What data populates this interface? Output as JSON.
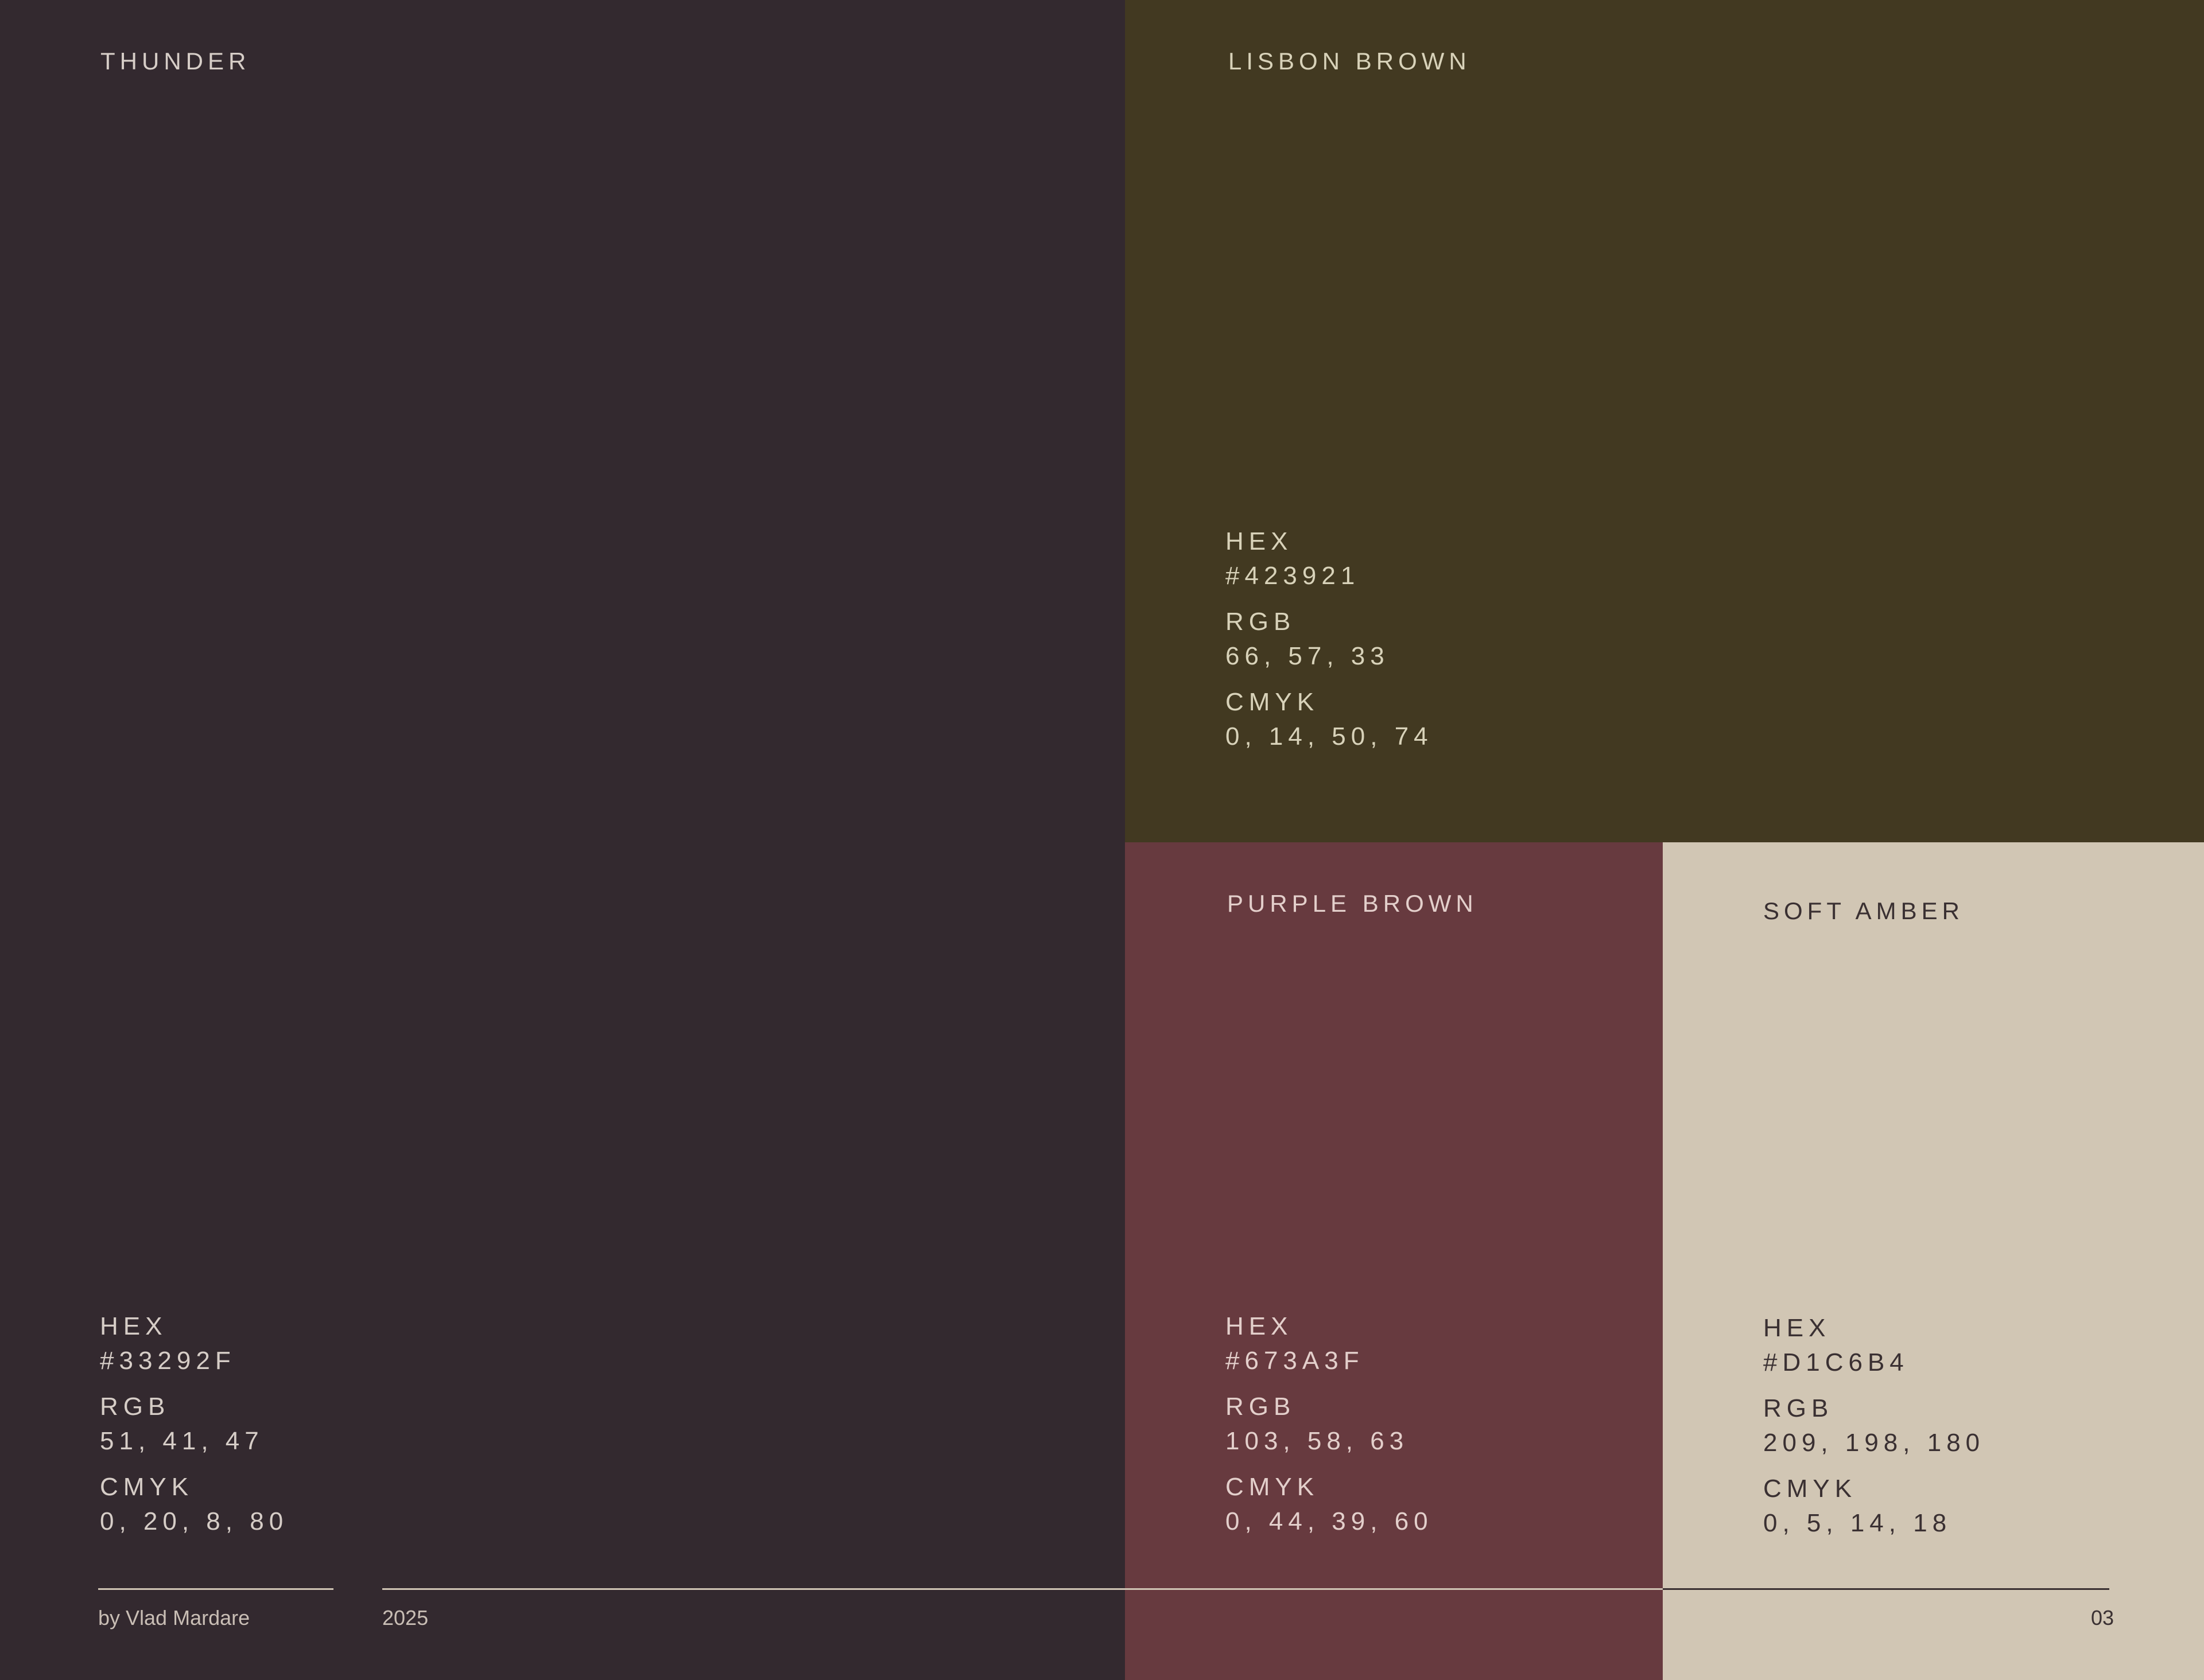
{
  "swatches": [
    {
      "name": "THUNDER",
      "color": "#33292F",
      "hex_label": "HEX",
      "hex": "#33292F",
      "rgb_label": "RGB",
      "rgb": "51, 41, 47",
      "cmyk_label": "CMYK",
      "cmyk": "0, 20, 8, 80"
    },
    {
      "name": "LISBON BROWN",
      "color": "#423921",
      "hex_label": "HEX",
      "hex": "#423921",
      "rgb_label": "RGB",
      "rgb": "66, 57, 33",
      "cmyk_label": "CMYK",
      "cmyk": "0, 14, 50, 74"
    },
    {
      "name": "PURPLE BROWN",
      "color": "#673A3F",
      "hex_label": "HEX",
      "hex": "#673A3F",
      "rgb_label": "RGB",
      "rgb": "103, 58, 63",
      "cmyk_label": "CMYK",
      "cmyk": "0, 44, 39, 60"
    },
    {
      "name": "SOFT AMBER",
      "color": "#D1C6B4",
      "hex_label": "HEX",
      "hex": "#D1C6B4",
      "rgb_label": "RGB",
      "rgb": "209, 198, 180",
      "cmyk_label": "CMYK",
      "cmyk": "0, 5, 14, 18"
    }
  ],
  "footer": {
    "author": "by Vlad Mardare",
    "year": "2025",
    "page": "03"
  }
}
